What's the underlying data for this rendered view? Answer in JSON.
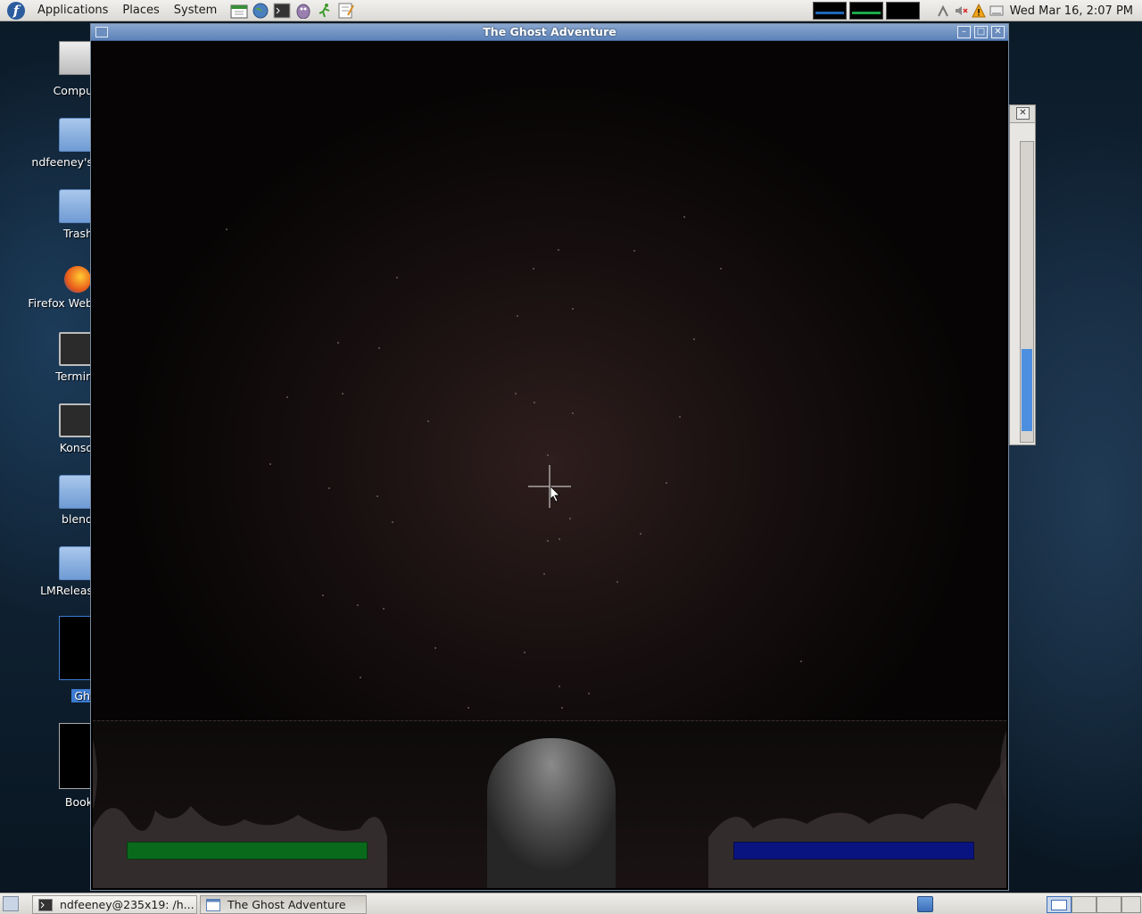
{
  "top_panel": {
    "menus": [
      "Applications",
      "Places",
      "System"
    ],
    "launchers": [
      "calendar-icon",
      "network-globe-icon",
      "terminal-icon",
      "pidgin-icon",
      "running-man-icon",
      "text-editor-icon"
    ],
    "workspaces": [
      {
        "bar_color": "#1e66b8"
      },
      {
        "bar_color": "#1ca84a"
      },
      {
        "bar_color": "#000000"
      }
    ],
    "clock": "Wed Mar 16,  2:07 PM"
  },
  "desktop": {
    "icons": [
      {
        "label": "Computer",
        "visible_label": "Compu",
        "icon": "computer-icon"
      },
      {
        "label": "ndfeeney's Home",
        "visible_label": "ndfeeney's",
        "icon": "home-folder-icon"
      },
      {
        "label": "Trash",
        "visible_label": "Trash",
        "icon": "trash-icon"
      },
      {
        "label": "Firefox Web Browser",
        "visible_label": "Firefox Web",
        "icon": "firefox-icon"
      },
      {
        "label": "Terminal",
        "visible_label": "Termin",
        "icon": "terminal-icon"
      },
      {
        "label": "Konsole",
        "visible_label": "Konso",
        "icon": "konsole-icon"
      },
      {
        "label": "blender",
        "visible_label": "blend",
        "icon": "folder-icon"
      },
      {
        "label": "LMRelease",
        "visible_label": "LMReleas",
        "icon": "folder-icon"
      },
      {
        "label": "Gh",
        "visible_label": "Gh",
        "icon": "thumbnail-icon"
      },
      {
        "label": "Book",
        "visible_label": "Book",
        "icon": "thumbnail-icon"
      }
    ]
  },
  "game_window": {
    "title": "The Ghost Adventure",
    "health_level": 1.0,
    "mana_level": 1.0,
    "health_color": "#0a6a1c",
    "mana_color": "#0a1481"
  },
  "taskbar": {
    "tasks": [
      {
        "label": "ndfeeney@235x19: /h...",
        "icon": "terminal-icon",
        "active": false
      },
      {
        "label": "The Ghost Adventure",
        "icon": "window-icon",
        "active": true
      }
    ]
  }
}
